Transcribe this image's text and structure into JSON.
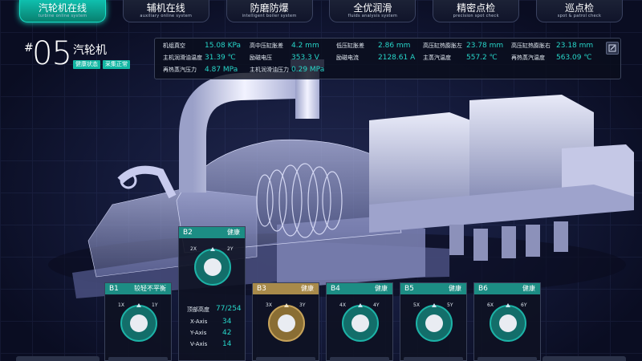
{
  "nav": [
    {
      "cn": "汽轮机在线",
      "en": "turbine online system",
      "active": true
    },
    {
      "cn": "辅机在线",
      "en": "auxiliary online system",
      "active": false
    },
    {
      "cn": "防磨防爆",
      "en": "intelligent boiler system",
      "active": false
    },
    {
      "cn": "全优润滑",
      "en": "fluids analysis system",
      "active": false
    },
    {
      "cn": "精密点检",
      "en": "precision spot check",
      "active": false
    },
    {
      "cn": "巡点检",
      "en": "spot & patrol check",
      "active": false
    }
  ],
  "title": {
    "hash": "#",
    "number": "05",
    "name": "汽轮机",
    "badge1": "健康状态",
    "badge2": "采集正常"
  },
  "params": {
    "r1": [
      {
        "label": "机组真空",
        "value": "15.08 KPa"
      },
      {
        "label": "高中压缸胀差",
        "value": "4.2 mm"
      },
      {
        "label": "低压缸胀差",
        "value": "2.86 mm"
      },
      {
        "label": "高压缸热膨胀左",
        "value": "23.78 mm"
      },
      {
        "label": "高压缸热膨胀右",
        "value": "23.18 mm"
      }
    ],
    "r2": [
      {
        "label": "主机润滑油温度",
        "value": "31.39 ℃"
      },
      {
        "label": "励磁电压",
        "value": "353.3 V"
      },
      {
        "label": "励磁电流",
        "value": "2128.61 A"
      },
      {
        "label": "主蒸汽温度",
        "value": "557.2 ℃"
      },
      {
        "label": "再热蒸汽温度",
        "value": "563.09 ℃"
      }
    ],
    "r3": [
      {
        "label": "再热蒸汽压力",
        "value": "4.87 MPa"
      },
      {
        "label": "主机润滑油压力",
        "value": "0.29 MPa"
      }
    ]
  },
  "bearings": {
    "b1": {
      "name": "B1",
      "status": "较轻不平衡",
      "x": "1X",
      "y": "1Y"
    },
    "b2": {
      "name": "B2",
      "status": "健康",
      "x": "2X",
      "y": "2Y"
    },
    "b3": {
      "name": "B3",
      "status": "健康",
      "x": "3X",
      "y": "3Y"
    },
    "b4": {
      "name": "B4",
      "status": "健康",
      "x": "4X",
      "y": "4Y"
    },
    "b5": {
      "name": "B5",
      "status": "健康",
      "x": "5X",
      "y": "5Y"
    },
    "b6": {
      "name": "B6",
      "status": "健康",
      "x": "6X",
      "y": "6Y"
    }
  },
  "b2info": {
    "top_label": "顶部高度",
    "top_value": "77/254",
    "x_label": "X-Axis",
    "x_value": "34",
    "y_label": "Y-Axis",
    "y_value": "42",
    "v_label": "V-Axis",
    "v_value": "14"
  },
  "colors": {
    "accent": "#19e3c9",
    "teal": "#1c8d84",
    "gold": "#a88a4a",
    "value": "#27d6c9"
  }
}
